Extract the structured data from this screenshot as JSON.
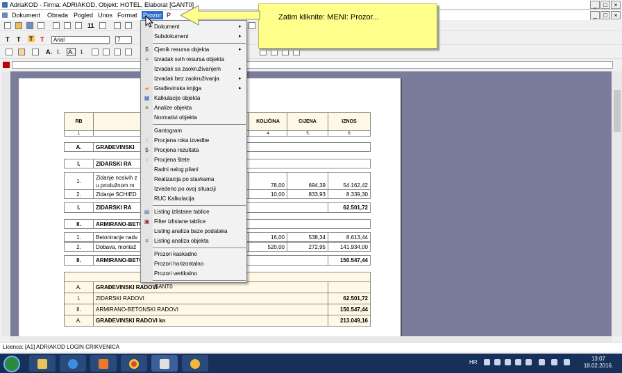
{
  "window": {
    "title": "AdriaKOD - Firma: ADRIAKOD,  Objekt: HOTEL, Elaborat [GANT0]"
  },
  "menubar": {
    "items": [
      "Dokument",
      "Obrada",
      "Pogled",
      "Unos",
      "Format",
      "Prozor",
      "P"
    ]
  },
  "toolbar": {
    "font_name": "Arial",
    "font_size": "7",
    "zoom_label": "11"
  },
  "callout": {
    "text": "Zatim kliknite: MENI: Prozor..."
  },
  "dropdown": {
    "groups": [
      [
        {
          "label": "Dokument",
          "arrow": true,
          "icon": ""
        },
        {
          "label": "Subdokument",
          "arrow": true,
          "icon": ""
        }
      ],
      [
        {
          "label": "Cjenik resursa objekta",
          "arrow": true,
          "icon": "dollar-icon"
        },
        {
          "label": "Izvadak svih resursa objekta",
          "arrow": false,
          "icon": "list-icon"
        },
        {
          "label": "Izvadak sa zaokruživanjem",
          "arrow": true,
          "icon": ""
        },
        {
          "label": "Izvadak bez zaokruživanja",
          "arrow": true,
          "icon": ""
        },
        {
          "label": "Građevinska knjiga",
          "arrow": true,
          "icon": "folder-icon"
        },
        {
          "label": "Kalkulacije objekta",
          "arrow": false,
          "icon": "calculator-icon"
        },
        {
          "label": "Analize objekta",
          "arrow": false,
          "icon": "list-icon"
        },
        {
          "label": "Normativi objekta",
          "arrow": false,
          "icon": ""
        }
      ],
      [
        {
          "label": "Gantogram",
          "arrow": false,
          "icon": ""
        },
        {
          "label": "Procjena roka izvedbe",
          "arrow": false,
          "icon": "key-icon"
        },
        {
          "label": "Procjena rezultata",
          "arrow": false,
          "icon": "dollar-icon"
        },
        {
          "label": "Procjena štete",
          "arrow": false,
          "icon": "key-icon"
        },
        {
          "label": "Radni nalog pilani",
          "arrow": false,
          "icon": ""
        },
        {
          "label": "Realizacija po stavkama",
          "arrow": false,
          "icon": ""
        },
        {
          "label": "Izvedeno po ovoj situaciji",
          "arrow": false,
          "icon": ""
        },
        {
          "label": "RUC Kalkulacija",
          "arrow": false,
          "icon": ""
        }
      ],
      [
        {
          "label": "Listing izlistane tablice",
          "arrow": false,
          "icon": "grid-icon"
        },
        {
          "label": "Filter izlistane tablice",
          "arrow": false,
          "icon": "filter-icon"
        },
        {
          "label": "Listing analiza baze podataka",
          "arrow": false,
          "icon": ""
        },
        {
          "label": "Listing analiza objekta",
          "arrow": false,
          "icon": "list-icon"
        }
      ],
      [
        {
          "label": "Prozori kaskadno",
          "arrow": false,
          "icon": ""
        },
        {
          "label": "Prozori horizontalno",
          "arrow": false,
          "icon": ""
        },
        {
          "label": "Prozori vertikalno",
          "arrow": false,
          "icon": ""
        }
      ],
      [
        {
          "label": "GANT0",
          "arrow": false,
          "icon": ""
        }
      ]
    ]
  },
  "table": {
    "headers": {
      "rb": "RB",
      "kolicina": "KOLIČINA",
      "cijena": "CIJENA",
      "iznos": "IZNOS"
    },
    "colnums": [
      "1",
      "4",
      "5",
      "6"
    ],
    "sec_a": {
      "rb": "A.",
      "text": "GRAĐEVINSKI"
    },
    "sec_i": {
      "rb": "I.",
      "text": "ZIDARSKI RA"
    },
    "row1": {
      "rb": "1.",
      "text1": "Zidanje nosivih z",
      "text2": "u produžnom m",
      "kol": "78,00",
      "cij": "694,39",
      "izn": "54.162,42"
    },
    "row2": {
      "rb": "2.",
      "text": "Zidanje SCHIED",
      "kol": "10,00",
      "cij": "833,93",
      "izn": "8.339,30"
    },
    "sum_i": {
      "rb": "I.",
      "text": "ZIDARSKI RA",
      "izn": "62.501,72"
    },
    "sec_ii": {
      "rb": "II.",
      "text": "ARMIRANO-BETO"
    },
    "row3": {
      "rb": "1.",
      "text": "Betoniranje nadv",
      "kol": "16,00",
      "cij": "538,34",
      "izn": "8.613,44"
    },
    "row4": {
      "rb": "2.",
      "text": "Dobava, montaž",
      "kol": "520,00",
      "cij": "272,95",
      "izn": "141.934,00"
    },
    "sum_ii": {
      "rb": "II.",
      "text": "ARMIRANO-BETO",
      "izn": "150.547,44"
    },
    "recap": [
      {
        "rb": "A.",
        "text": "GRAĐEVINSKI RADOVI",
        "izn": "",
        "bold": true
      },
      {
        "rb": "I.",
        "text": "ZIDARSKI RADOVI",
        "izn": "62.501,72",
        "bold": false
      },
      {
        "rb": "II.",
        "text": "ARMIRANO-BETONSKI RADOVI",
        "izn": "150.547,44",
        "bold": false
      },
      {
        "rb": "A.",
        "text": "GRAĐEVINSKI RADOVI kn",
        "izn": "213.049,16",
        "bold": true
      }
    ]
  },
  "statusbar": {
    "text": "Licenca: [A1] ADRIAKOD LOGIN CRIKVENICA"
  },
  "taskbar": {
    "lang": "HR",
    "time": "13:07",
    "date": "18.02.2016."
  }
}
